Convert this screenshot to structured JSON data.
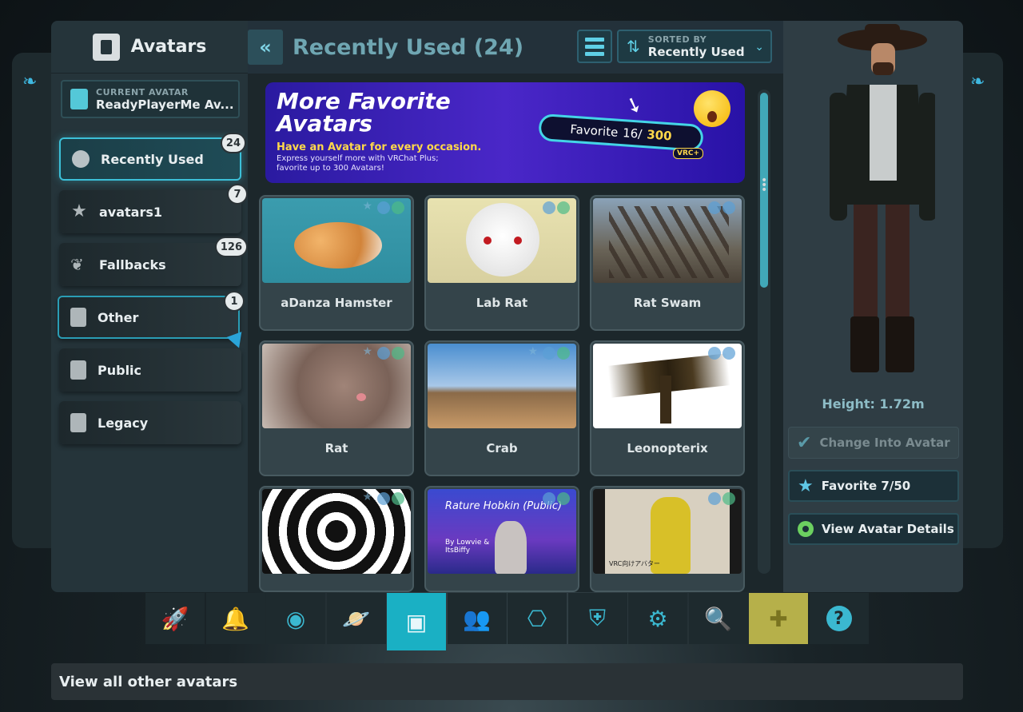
{
  "left": {
    "title": "Avatars",
    "current_avatar": {
      "label": "CURRENT AVATAR",
      "name": "ReadyPlayerMe Av..."
    },
    "categories": [
      {
        "label": "Recently Used",
        "count": "24"
      },
      {
        "label": "avatars1",
        "count": "7"
      },
      {
        "label": "Fallbacks",
        "count": "126"
      },
      {
        "label": "Other",
        "count": "1"
      },
      {
        "label": "Public",
        "count": ""
      },
      {
        "label": "Legacy",
        "count": ""
      }
    ]
  },
  "main": {
    "back_label": "«",
    "title": "Recently Used (24)",
    "sort": {
      "label": "SORTED BY",
      "value": "Recently Used"
    },
    "banner": {
      "title_line1": "More Favorite",
      "title_line2": "Avatars",
      "subtitle": "Have an Avatar for every occasion.",
      "small1": "Express yourself more with VRChat Plus;",
      "small2": "favorite up to 300 Avatars!",
      "pill_label": "Favorite",
      "pill_value": "16/",
      "pill_max": "300",
      "vrc": "VRC+"
    },
    "avatars": [
      {
        "name": "aDanza Hamster"
      },
      {
        "name": "Lab Rat"
      },
      {
        "name": "Rat Swam"
      },
      {
        "name": "Rat"
      },
      {
        "name": "Crab"
      },
      {
        "name": "Leonopterix"
      },
      {
        "name": ""
      },
      {
        "name": "",
        "thumb_text": "Rature Hobkin (Public)",
        "thumb_sub": "By Lowvie & ItsBiffy"
      },
      {
        "name": "",
        "thumb_text": "VRC向けアバター"
      }
    ]
  },
  "right": {
    "height": "Height: 1.72m",
    "change_label": "Change Into Avatar",
    "favorite_label": "Favorite 7/50",
    "details_label": "View Avatar Details"
  },
  "dock": {
    "icons": [
      "rocket-icon",
      "bell-icon",
      "user-icon",
      "planet-icon",
      "avatar-book-icon",
      "group-icon",
      "network-icon",
      "shield-icon",
      "gear-icon",
      "search-icon",
      "chat-add-icon",
      "help-icon"
    ]
  },
  "tooltip": "View all other avatars",
  "colors": {
    "accent": "#3cc0d8",
    "active_tab": "#1ab0c4",
    "chat": "#b6b04a"
  }
}
